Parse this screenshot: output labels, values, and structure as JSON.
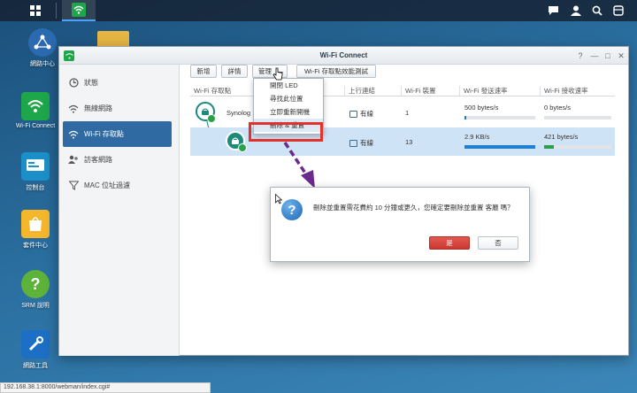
{
  "window": {
    "title": "Wi-Fi Connect",
    "help_glyph": "?",
    "minimize_glyph": "—",
    "maximize_glyph": "□",
    "close_glyph": "✕"
  },
  "desktop_icons": [
    {
      "label": "網路中心",
      "icon": "network-center-icon"
    },
    {
      "label": "Wi-Fi Connect",
      "icon": "wifi-connect-icon"
    },
    {
      "label": "控制台",
      "icon": "control-panel-icon"
    },
    {
      "label": "套件中心",
      "icon": "package-center-icon"
    },
    {
      "label": "SRM 說明",
      "icon": "help-icon"
    },
    {
      "label": "網路工具",
      "icon": "network-tools-icon"
    }
  ],
  "sidebar": {
    "items": [
      {
        "label": "狀態",
        "icon": "status-icon"
      },
      {
        "label": "無線網路",
        "icon": "wireless-icon"
      },
      {
        "label": "Wi-Fi 存取點",
        "icon": "access-point-icon"
      },
      {
        "label": "訪客網路",
        "icon": "guest-network-icon"
      },
      {
        "label": "MAC 位址過濾",
        "icon": "mac-filter-icon"
      }
    ],
    "active_index": 2
  },
  "toolbar": {
    "add": "新增",
    "details": "詳情",
    "manage": "管理",
    "test": "Wi-Fi 存取點效能測試"
  },
  "table": {
    "headers": [
      "Wi-Fi 存取點",
      "上行連結",
      "Wi-Fi 裝置",
      "Wi-Fi 發送速率",
      "Wi-Fi 接收速率"
    ],
    "rows": [
      {
        "name": "Synolog",
        "uplink": "有線",
        "devices": "1",
        "send": "500 bytes/s",
        "send_level": 0.03,
        "recv": "0 bytes/s",
        "recv_level": 0.0
      },
      {
        "name": "",
        "uplink": "有線",
        "devices": "13",
        "send": "2.9 KB/s",
        "send_level": 1.0,
        "recv": "421 bytes/s",
        "recv_level": 0.14
      }
    ]
  },
  "menu": {
    "items": [
      "開閉 LED",
      "尋找此位置",
      "立即重新開機",
      "刪除 & 重置"
    ],
    "highlighted_index": 3
  },
  "dialog": {
    "message": "刪除並重置需花費約 10 分鐘或更久，您確定要刪除並重置 客廳 嗎？",
    "yes": "是",
    "no": "否",
    "icon_glyph": "?"
  },
  "status_url": "192.168.38.1:8000/webman/index.cgi#",
  "colors": {
    "accent": "#2f6aa3",
    "wifi_green": "#1ea64a",
    "danger": "#e0332b",
    "bar_fill": "#1f7fd0",
    "bar_fill_green": "#2aa24a",
    "arrow": "#6b2a8c"
  }
}
